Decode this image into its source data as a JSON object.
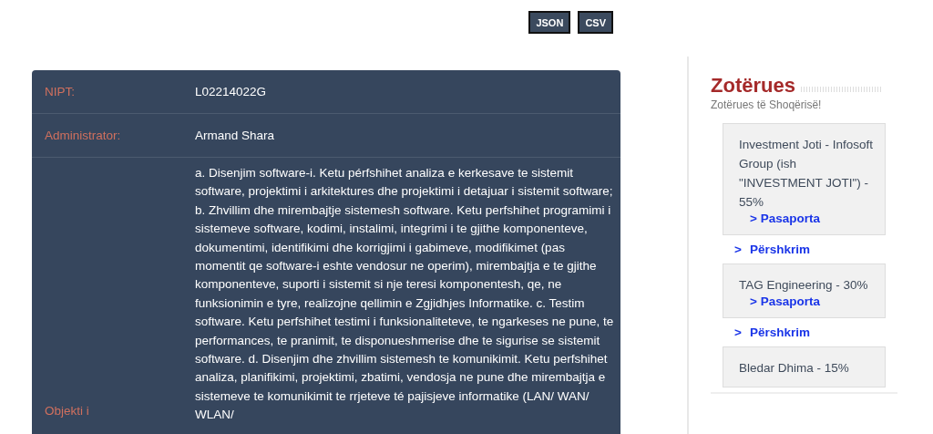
{
  "export_buttons": [
    "JSON",
    "CSV"
  ],
  "details": [
    {
      "label": "NIPT:",
      "value": "L02214022G"
    },
    {
      "label": "Administrator:",
      "value": "Armand Shara"
    },
    {
      "label": "Objekti i",
      "value": "a. Disenjim software-i. Ketu pérfshihet analiza e kerkesave te sistemit software, projektimi i arkitektures dhe projektimi i detajuar i sistemit software; b. Zhvillim dhe mirembajtje sistemesh software. Ketu perfshihet programimi i sistemeve software, kodimi, instalimi, integrimi i te gjithe komponenteve, dokumentimi, identifikimi dhe korrigjimi i gabimeve, modifikimet (pas momentit qe software-i eshte vendosur ne operim), mirembajtja e te gjithe komponenteve, suporti i sistemit si nje teresi komponentesh, qe, ne funksionimin e tyre, realizojne qellimin e Zgjidhjes Informatike. c. Testim software. Ketu perfshihet testimi i funksionaliteteve, te ngarkeses ne pune, te performances, te pranimit, te disponueshmerise dhe te sigurise se sistemit software. d. Disenjim dhe zhvillim sistemesh te komunikimit. Ketu perfshihet analiza, planifikimi, projektimi, zbatimi, vendosja ne pune dhe mirembajtja e sistemeve te komunikimit te rrjeteve té pajisjeve informatike (LAN/ WAN/ WLAN/"
    }
  ],
  "sidebar": {
    "title": "Zotërues",
    "subtitle": "Zotërues të Shoqërisë!",
    "owners": [
      {
        "name": "Investment Joti - Infosoft Group (ish \"INVESTMENT JOTI\") - 55%",
        "passport_link": "> Pasaporta",
        "description_link": "Përshkrim",
        "description_caret": ">"
      },
      {
        "name": "TAG Engineering - 30%",
        "passport_link": "> Pasaporta",
        "description_link": "Përshkrim",
        "description_caret": ">"
      },
      {
        "name": "Bledar Dhima - 15%"
      }
    ]
  }
}
